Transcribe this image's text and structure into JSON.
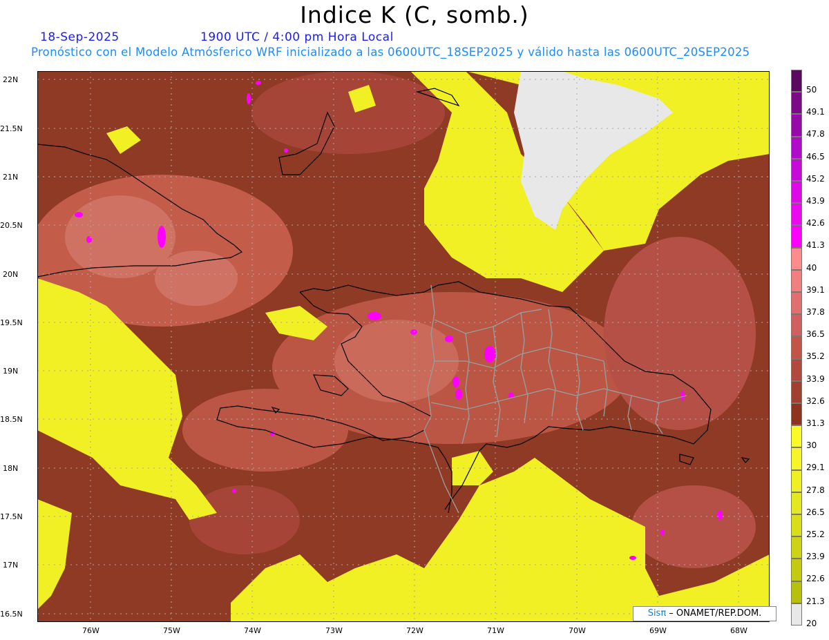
{
  "header": {
    "title": "Indice K (C, somb.)",
    "date": "18-Sep-2025",
    "time": "1900 UTC / 4:00 pm Hora Local",
    "forecast_note": "Pronóstico con el Modelo Atmósferico WRF inicializado a las 0600UTC_18SEP2025 y válido hasta las  0600UTC_20SEP2025"
  },
  "axes": {
    "lat_labels": [
      "22N",
      "21.5N",
      "21N",
      "20.5N",
      "20N",
      "19.5N",
      "19N",
      "18.5N",
      "18N",
      "17.5N",
      "17N",
      "16.5N"
    ],
    "lon_labels": [
      "76W",
      "75W",
      "74W",
      "73W",
      "72W",
      "71W",
      "70W",
      "69W",
      "68W"
    ]
  },
  "colorbar": {
    "labels": [
      "50",
      "49.1",
      "47.8",
      "46.5",
      "45.2",
      "43.9",
      "42.6",
      "41.3",
      "40",
      "39.1",
      "37.8",
      "36.5",
      "35.2",
      "33.9",
      "32.6",
      "31.3",
      "30",
      "29.1",
      "27.8",
      "26.5",
      "25.2",
      "23.9",
      "22.6",
      "21.3",
      "20"
    ],
    "colors": [
      "#5a0a5e",
      "#7a0a86",
      "#960aa8",
      "#b10ac8",
      "#c80ad8",
      "#dc0ae6",
      "#ea0af0",
      "#ff00ff",
      "#ff8c8c",
      "#f08080",
      "#e07070",
      "#d06060",
      "#c05548",
      "#b04a3c",
      "#a04030",
      "#8c3420",
      "#fafa2a",
      "#f5f528",
      "#eef025",
      "#e4e820",
      "#d9de1b",
      "#cdd416",
      "#c2ca12",
      "#b8c00e",
      "#e8e8e8"
    ]
  },
  "credit": {
    "brand": "Sisπ",
    "rest": " – ONAMET/REP.DOM."
  }
}
